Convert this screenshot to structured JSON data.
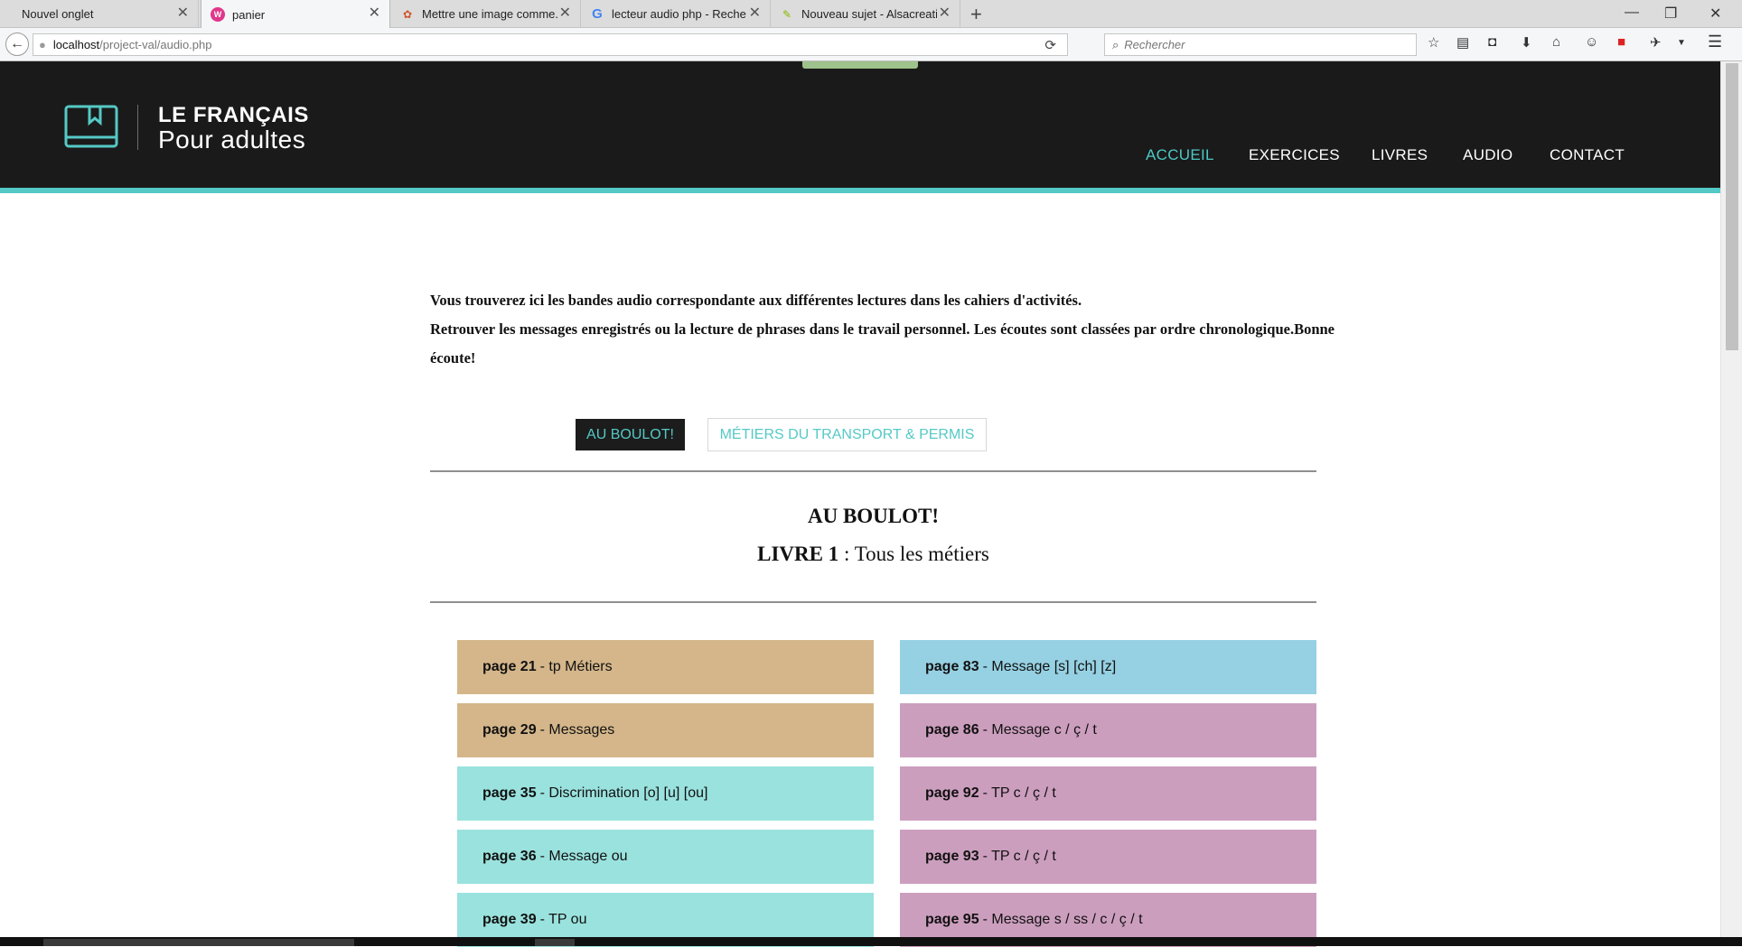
{
  "browser": {
    "tabs": [
      {
        "label": "Nouvel onglet",
        "icon": "blank-icon",
        "color": ""
      },
      {
        "label": "panier",
        "icon": "wamp-icon",
        "color": "#e0378b"
      },
      {
        "label": "Mettre une image comme...",
        "icon": "puzzle-icon",
        "color": "#d0542c"
      },
      {
        "label": "lecteur audio php - Reche...",
        "icon": "google-icon",
        "color": "#4285f4"
      },
      {
        "label": "Nouveau sujet - Alsacreati...",
        "icon": "alsacreations-icon",
        "color": "#8ab800"
      }
    ],
    "url_host": "localhost",
    "url_path": "/project-val/audio.php",
    "search_placeholder": "Rechercher"
  },
  "site": {
    "logo_top": "LE FRANÇAIS",
    "logo_bottom": "Pour adultes",
    "accent_color": "#55c9c6",
    "nav": [
      {
        "label": "ACCUEIL",
        "active": true
      },
      {
        "label": "EXERCICES",
        "active": false
      },
      {
        "label": "LIVRES",
        "active": false
      },
      {
        "label": "AUDIO",
        "active": false
      },
      {
        "label": "CONTACT",
        "active": false
      }
    ]
  },
  "main": {
    "intro_line1": "Vous trouverez ici les bandes audio correspondante aux différentes lectures dans les cahiers d'activités.",
    "intro_line2": "Retrouver les messages enregistrés ou la lecture de phrases dans le travail personnel. Les écoutes sont classées par ordre chronologique.Bonne écoute!",
    "tabs": [
      {
        "label": "AU BOULOT!",
        "active": true
      },
      {
        "label": "MÉTIERS DU TRANSPORT & PERMIS",
        "active": false
      }
    ],
    "section_title": "AU BOULOT!",
    "section_sub_bold": "LIVRE 1",
    "section_sub_rest": " : Tous les métiers",
    "left_items": [
      {
        "page": "page 21",
        "text": "- tp Métiers",
        "color": "#d4b68a"
      },
      {
        "page": "page 29",
        "text": "- Messages",
        "color": "#d4b68a"
      },
      {
        "page": "page 35",
        "text": "- Discrimination [o] [u] [ou]",
        "color": "#9ae2de"
      },
      {
        "page": "page 36",
        "text": "- Message ou",
        "color": "#9ae2de"
      },
      {
        "page": "page 39",
        "text": "- TP ou",
        "color": "#9ae2de"
      }
    ],
    "right_items": [
      {
        "page": "page 83",
        "text": "- Message [s] [ch] [z]",
        "color": "#96d1e3"
      },
      {
        "page": "page 86",
        "text": "- Message c / ç / t",
        "color": "#cc9ebe"
      },
      {
        "page": "page 92",
        "text": "- TP c / ç / t",
        "color": "#cc9ebe"
      },
      {
        "page": "page 93",
        "text": "- TP c / ç / t",
        "color": "#cc9ebe"
      },
      {
        "page": "page 95",
        "text": "- Message s / ss / c / ç / t",
        "color": "#cc9ebe"
      }
    ]
  }
}
